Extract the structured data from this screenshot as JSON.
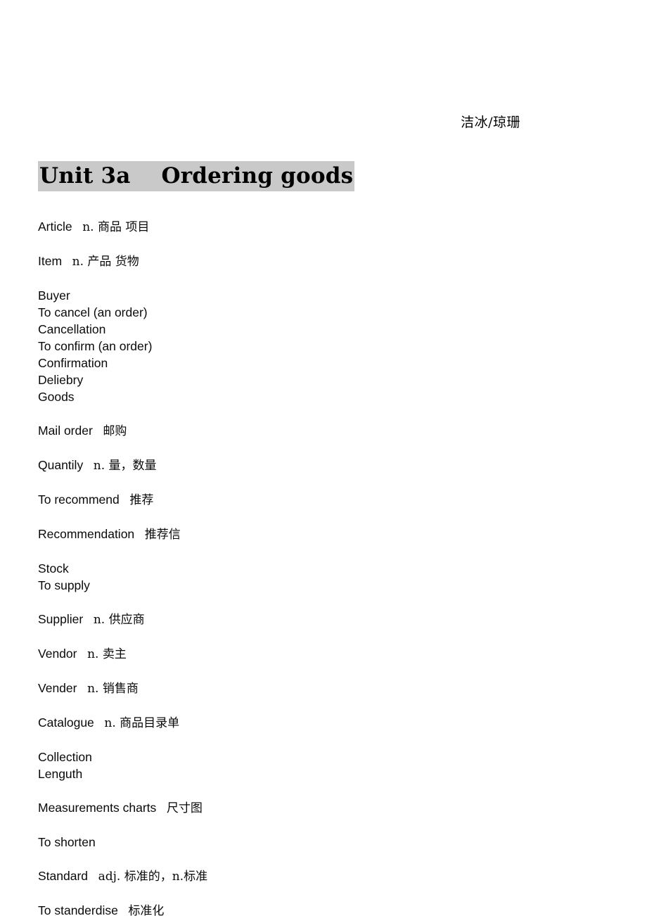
{
  "document": {
    "header": "洁冰/琼珊",
    "title": "Unit 3a    Ordering goods",
    "highlight_color": "#c9c9c9",
    "page_background": "#ffffff",
    "text_color": "#000000"
  },
  "vocabulary": [
    {
      "term": "Article",
      "gloss": "n. 商品 项目",
      "spacer_before": false
    },
    {
      "term": "Item",
      "gloss": "n. 产品 货物",
      "spacer_before": true
    },
    {
      "term": "Buyer",
      "gloss": "",
      "spacer_before": true
    },
    {
      "term": "To cancel (an order)",
      "gloss": "",
      "spacer_before": false
    },
    {
      "term": "Cancellation",
      "gloss": "",
      "spacer_before": false
    },
    {
      "term": "To confirm (an order)",
      "gloss": "",
      "spacer_before": false
    },
    {
      "term": "Confirmation",
      "gloss": "",
      "spacer_before": false
    },
    {
      "term": "Deliebry",
      "gloss": "",
      "spacer_before": false
    },
    {
      "term": "Goods",
      "gloss": "",
      "spacer_before": false
    },
    {
      "term": "Mail order",
      "gloss": "邮购",
      "spacer_before": true
    },
    {
      "term": "Quantily",
      "gloss": "n. 量，数量",
      "spacer_before": true
    },
    {
      "term": "To recommend",
      "gloss": "推荐",
      "spacer_before": true
    },
    {
      "term": "Recommendation",
      "gloss": "推荐信",
      "spacer_before": true
    },
    {
      "term": "Stock",
      "gloss": "",
      "spacer_before": true
    },
    {
      "term": "To supply",
      "gloss": "",
      "spacer_before": false
    },
    {
      "term": "Supplier",
      "gloss": "n. 供应商",
      "spacer_before": true
    },
    {
      "term": "Vendor",
      "gloss": "n. 卖主",
      "spacer_before": true
    },
    {
      "term": "Vender",
      "gloss": "n. 销售商",
      "spacer_before": true
    },
    {
      "term": "Catalogue",
      "gloss": "n. 商品目录单",
      "spacer_before": true
    },
    {
      "term": "Collection",
      "gloss": "",
      "spacer_before": true
    },
    {
      "term": "Lenguth",
      "gloss": "",
      "spacer_before": false
    },
    {
      "term": "Measurements charts",
      "gloss": "尺寸图",
      "spacer_before": true
    },
    {
      "term": "To shorten",
      "gloss": "",
      "spacer_before": true
    },
    {
      "term": "Standard",
      "gloss": "adj. 标准的，n.标准",
      "spacer_before": true
    },
    {
      "term": "To standerdise",
      "gloss": "标准化",
      "spacer_before": true
    }
  ],
  "spacing": {
    "term_gloss_separator": "   "
  }
}
